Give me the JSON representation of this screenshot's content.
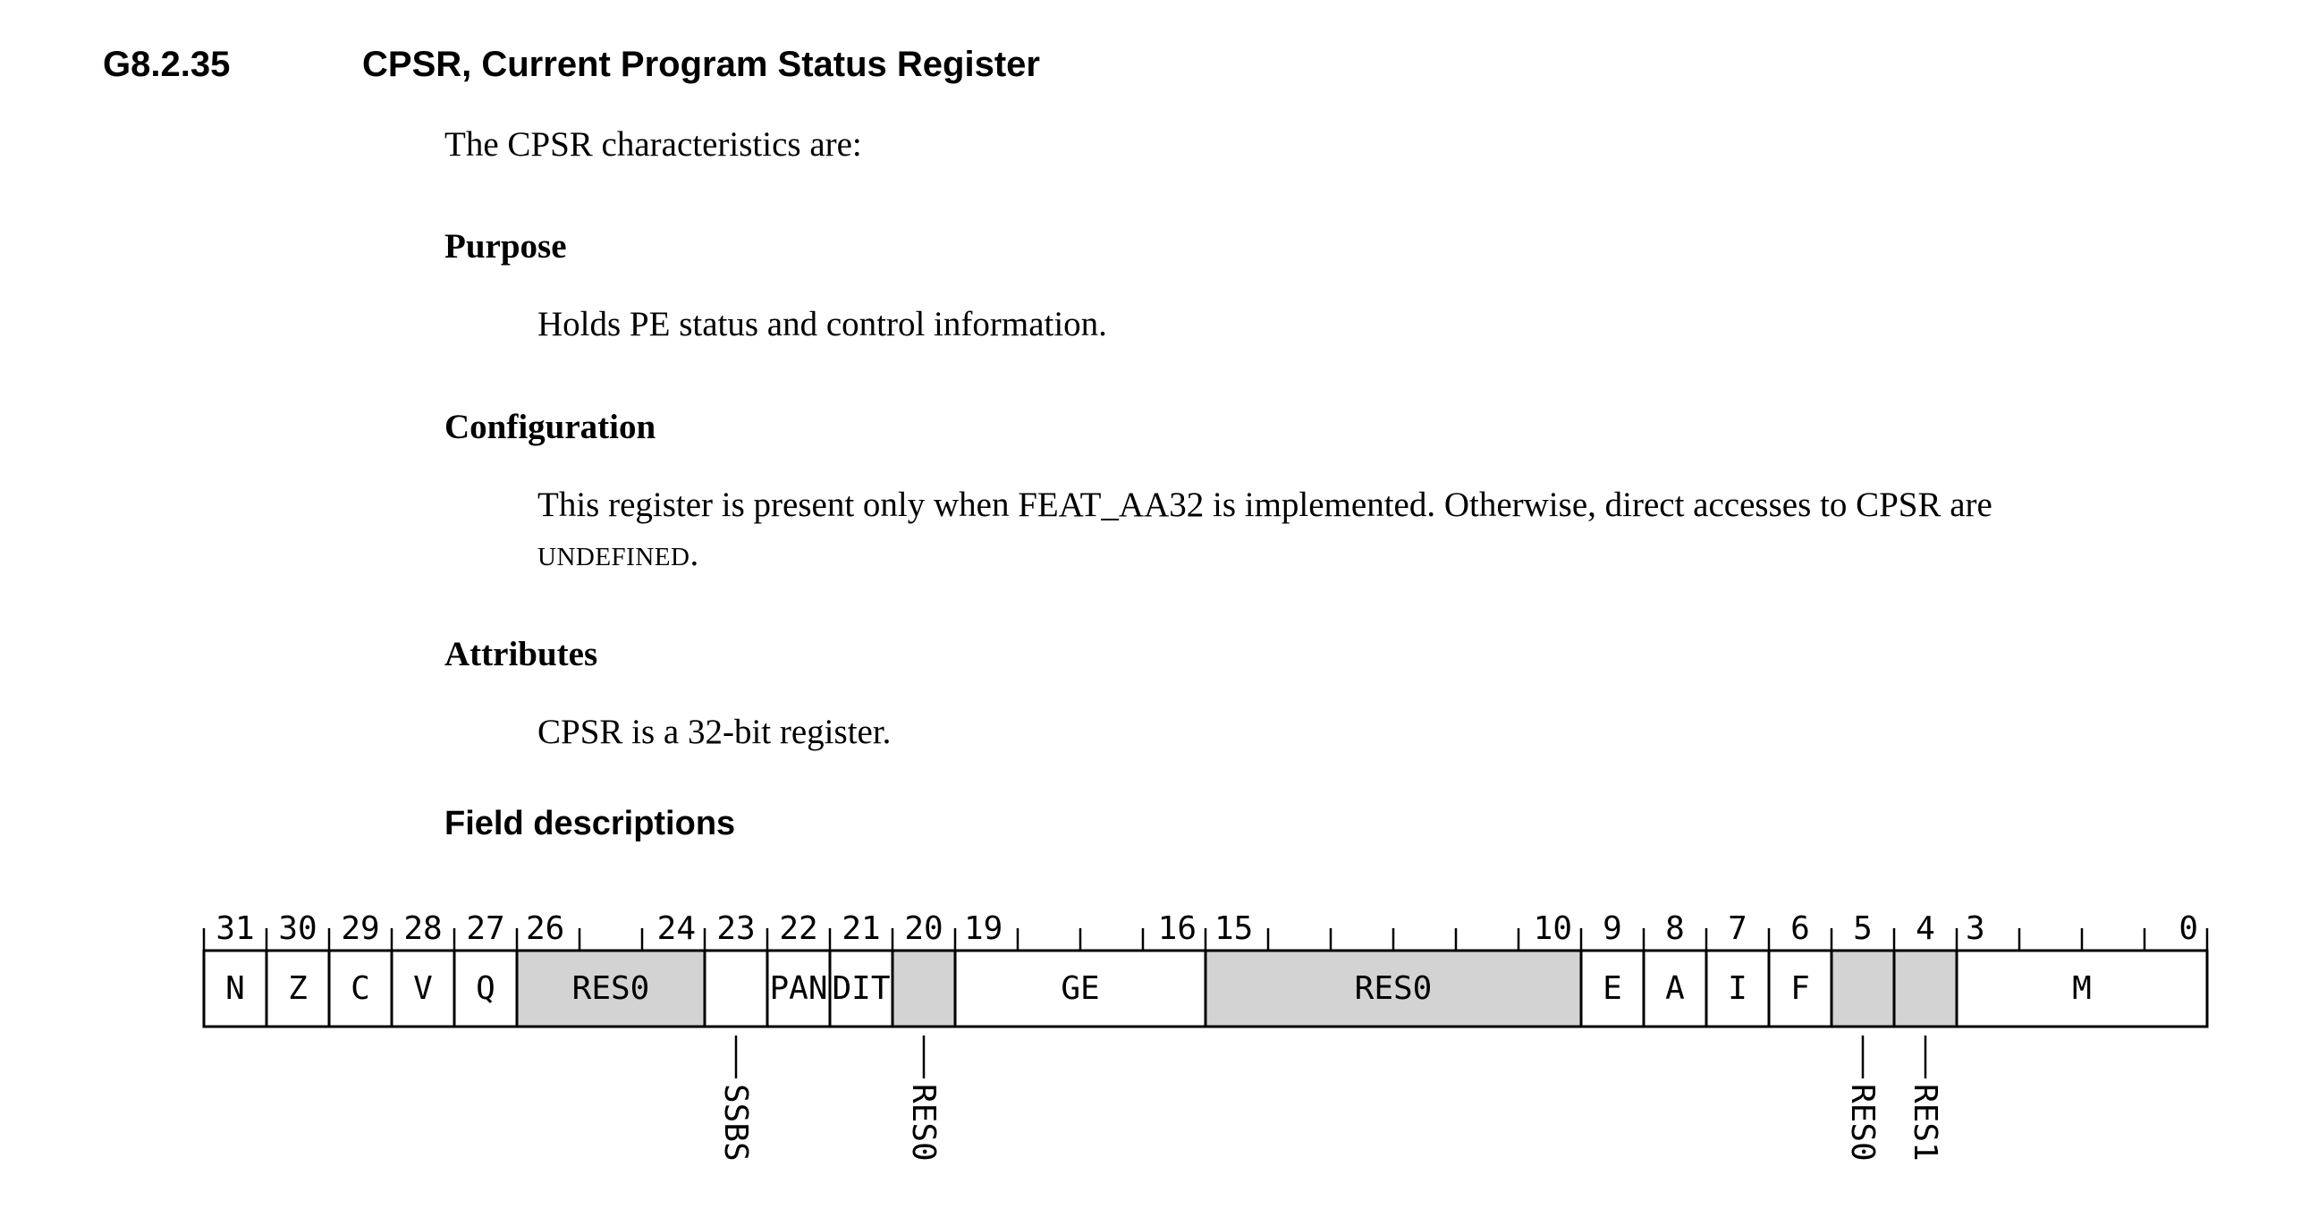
{
  "section": {
    "number": "G8.2.35",
    "title": "CPSR, Current Program Status Register"
  },
  "intro": "The CPSR characteristics are:",
  "purpose": {
    "heading": "Purpose",
    "text": "Holds PE status and control information."
  },
  "configuration": {
    "heading": "Configuration",
    "text_line1": "This register is present only when FEAT_AA32 is implemented. Otherwise, direct accesses to CPSR are",
    "text_line2_smallcaps": "UNDEFINED",
    "text_line2_tail": "."
  },
  "attributes": {
    "heading": "Attributes",
    "text": "CPSR is a 32-bit register."
  },
  "field_descriptions": {
    "heading": "Field descriptions",
    "register": {
      "width_bits": 32,
      "bit_labels": [
        "31",
        "30",
        "29",
        "28",
        "27",
        "26",
        "24",
        "23",
        "22",
        "21",
        "20",
        "19",
        "16",
        "15",
        "10",
        "9",
        "8",
        "7",
        "6",
        "5",
        "4",
        "3",
        "0"
      ],
      "fields": [
        {
          "name": "N",
          "hi": 31,
          "lo": 31,
          "reserved": false,
          "inline": true
        },
        {
          "name": "Z",
          "hi": 30,
          "lo": 30,
          "reserved": false,
          "inline": true
        },
        {
          "name": "C",
          "hi": 29,
          "lo": 29,
          "reserved": false,
          "inline": true
        },
        {
          "name": "V",
          "hi": 28,
          "lo": 28,
          "reserved": false,
          "inline": true
        },
        {
          "name": "Q",
          "hi": 27,
          "lo": 27,
          "reserved": false,
          "inline": true
        },
        {
          "name": "RES0",
          "hi": 26,
          "lo": 24,
          "reserved": true,
          "inline": true
        },
        {
          "name": "SSBS",
          "hi": 23,
          "lo": 23,
          "reserved": false,
          "inline": false
        },
        {
          "name": "PAN",
          "hi": 22,
          "lo": 22,
          "reserved": false,
          "inline": true
        },
        {
          "name": "DIT",
          "hi": 21,
          "lo": 21,
          "reserved": false,
          "inline": true
        },
        {
          "name": "RES0",
          "hi": 20,
          "lo": 20,
          "reserved": true,
          "inline": false
        },
        {
          "name": "GE",
          "hi": 19,
          "lo": 16,
          "reserved": false,
          "inline": true
        },
        {
          "name": "RES0",
          "hi": 15,
          "lo": 10,
          "reserved": true,
          "inline": true
        },
        {
          "name": "E",
          "hi": 9,
          "lo": 9,
          "reserved": false,
          "inline": true
        },
        {
          "name": "A",
          "hi": 8,
          "lo": 8,
          "reserved": false,
          "inline": true
        },
        {
          "name": "I",
          "hi": 7,
          "lo": 7,
          "reserved": false,
          "inline": true
        },
        {
          "name": "F",
          "hi": 6,
          "lo": 6,
          "reserved": false,
          "inline": true
        },
        {
          "name": "RES0",
          "hi": 5,
          "lo": 5,
          "reserved": true,
          "inline": false
        },
        {
          "name": "RES1",
          "hi": 4,
          "lo": 4,
          "reserved": true,
          "inline": false
        },
        {
          "name": "M",
          "hi": 3,
          "lo": 0,
          "reserved": false,
          "inline": true
        }
      ],
      "colors": {
        "reserved_fill": "#d3d3d3",
        "line": "#000000"
      }
    }
  }
}
